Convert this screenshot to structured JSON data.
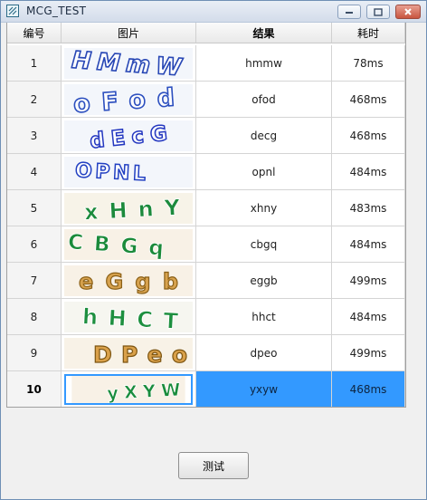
{
  "window": {
    "title": "MCG_TEST"
  },
  "table": {
    "headers": [
      "编号",
      "图片",
      "结果",
      "耗时"
    ],
    "rows": [
      {
        "no": "1",
        "result": "hmmw",
        "time": "78ms",
        "captcha_text": "HMmW"
      },
      {
        "no": "2",
        "result": "ofod",
        "time": "468ms",
        "captcha_text": "oFod"
      },
      {
        "no": "3",
        "result": "decg",
        "time": "468ms",
        "captcha_text": "dEcG"
      },
      {
        "no": "4",
        "result": "opnl",
        "time": "484ms",
        "captcha_text": "OPNL"
      },
      {
        "no": "5",
        "result": "xhny",
        "time": "483ms",
        "captcha_text": "xHnY"
      },
      {
        "no": "6",
        "result": "cbgq",
        "time": "484ms",
        "captcha_text": "CBGq"
      },
      {
        "no": "7",
        "result": "eggb",
        "time": "499ms",
        "captcha_text": "eGgb"
      },
      {
        "no": "8",
        "result": "hhct",
        "time": "484ms",
        "captcha_text": "hHCT"
      },
      {
        "no": "9",
        "result": "dpeo",
        "time": "499ms",
        "captcha_text": "DPeo"
      },
      {
        "no": "10",
        "result": "yxyw",
        "time": "468ms",
        "captcha_text": "yXYW"
      }
    ],
    "selected_row": "10"
  },
  "actions": {
    "test_button": "测试"
  },
  "colors": {
    "selection": "#3399ff",
    "header_bg": "#f0f0f0"
  }
}
